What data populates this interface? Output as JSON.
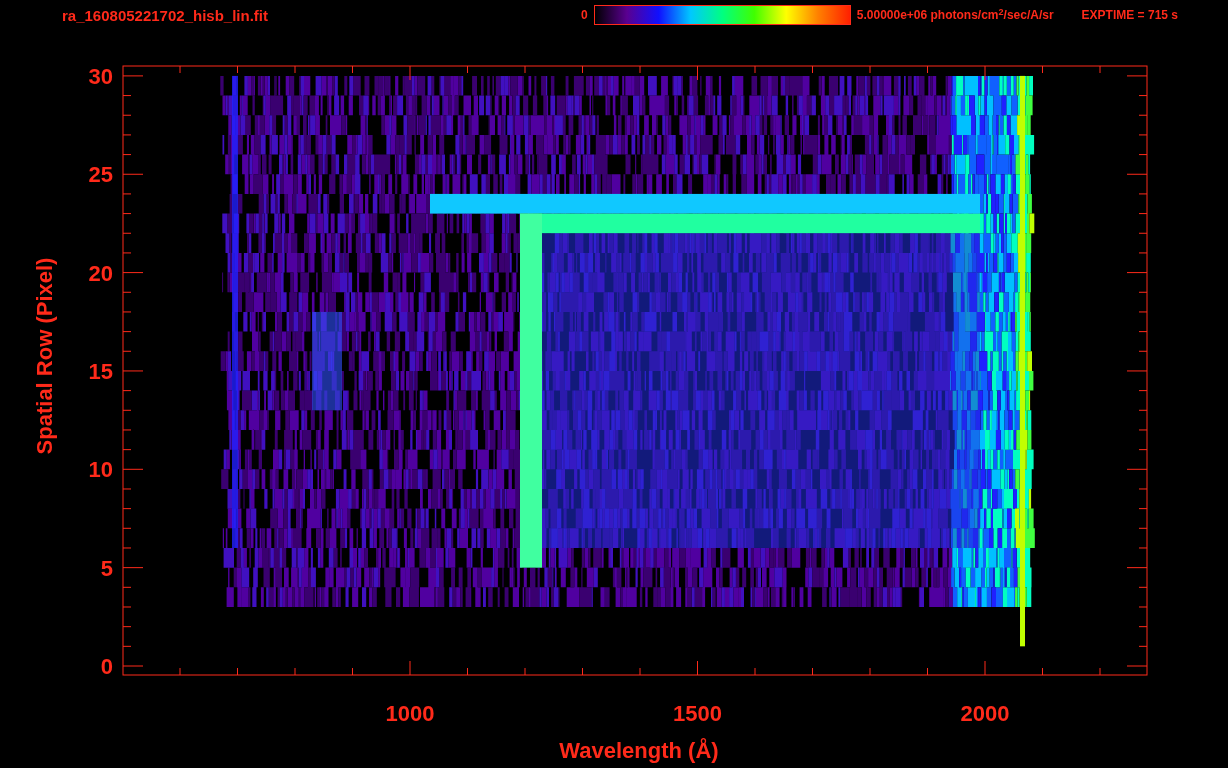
{
  "header": {
    "filename": "ra_160805221702_hisb_lin.fit",
    "colorbar_min": "0",
    "colorbar_max": "5.00000e+06 photons/cm$^{2}$/sec/A/sr",
    "exptime": "EXPTIME = 715 s"
  },
  "plot": {
    "xlabel": "Wavelength (Å)",
    "ylabel": "Spatial Row (Pixel)",
    "xtick_labels": [
      "1000",
      "1500",
      "2000"
    ],
    "ytick_labels": [
      "30",
      "25",
      "20",
      "15",
      "10",
      "5",
      "0"
    ]
  }
}
